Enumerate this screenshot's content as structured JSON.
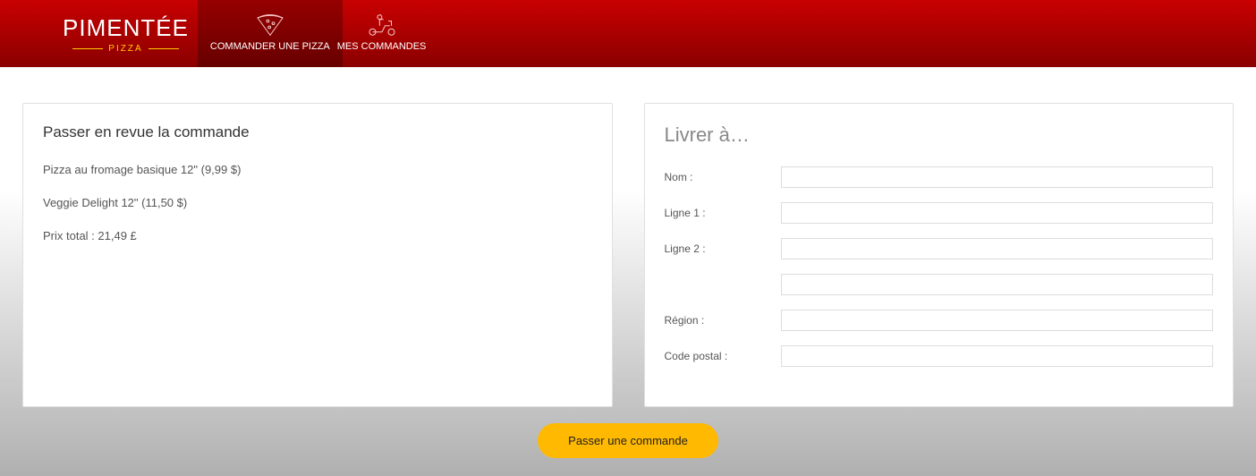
{
  "brand": {
    "name": "PIMENTÉE",
    "sub": "PIZZA"
  },
  "nav": {
    "order": "COMMANDER UNE PIZZA",
    "my_orders": "MES COMMANDES"
  },
  "review": {
    "title": "Passer en revue la commande",
    "items": [
      "Pizza au fromage basique 12\" (9,99 $)",
      "Veggie Delight 12\" (11,50 $)"
    ],
    "total": "Prix total : 21,49 £"
  },
  "deliver": {
    "title": "Livrer à…",
    "labels": {
      "name": "Nom :",
      "line1": "Ligne 1 :",
      "line2": "Ligne 2 :",
      "city": "",
      "region": "Région :",
      "postal": "Code postal :"
    }
  },
  "actions": {
    "place_order": "Passer une commande"
  }
}
